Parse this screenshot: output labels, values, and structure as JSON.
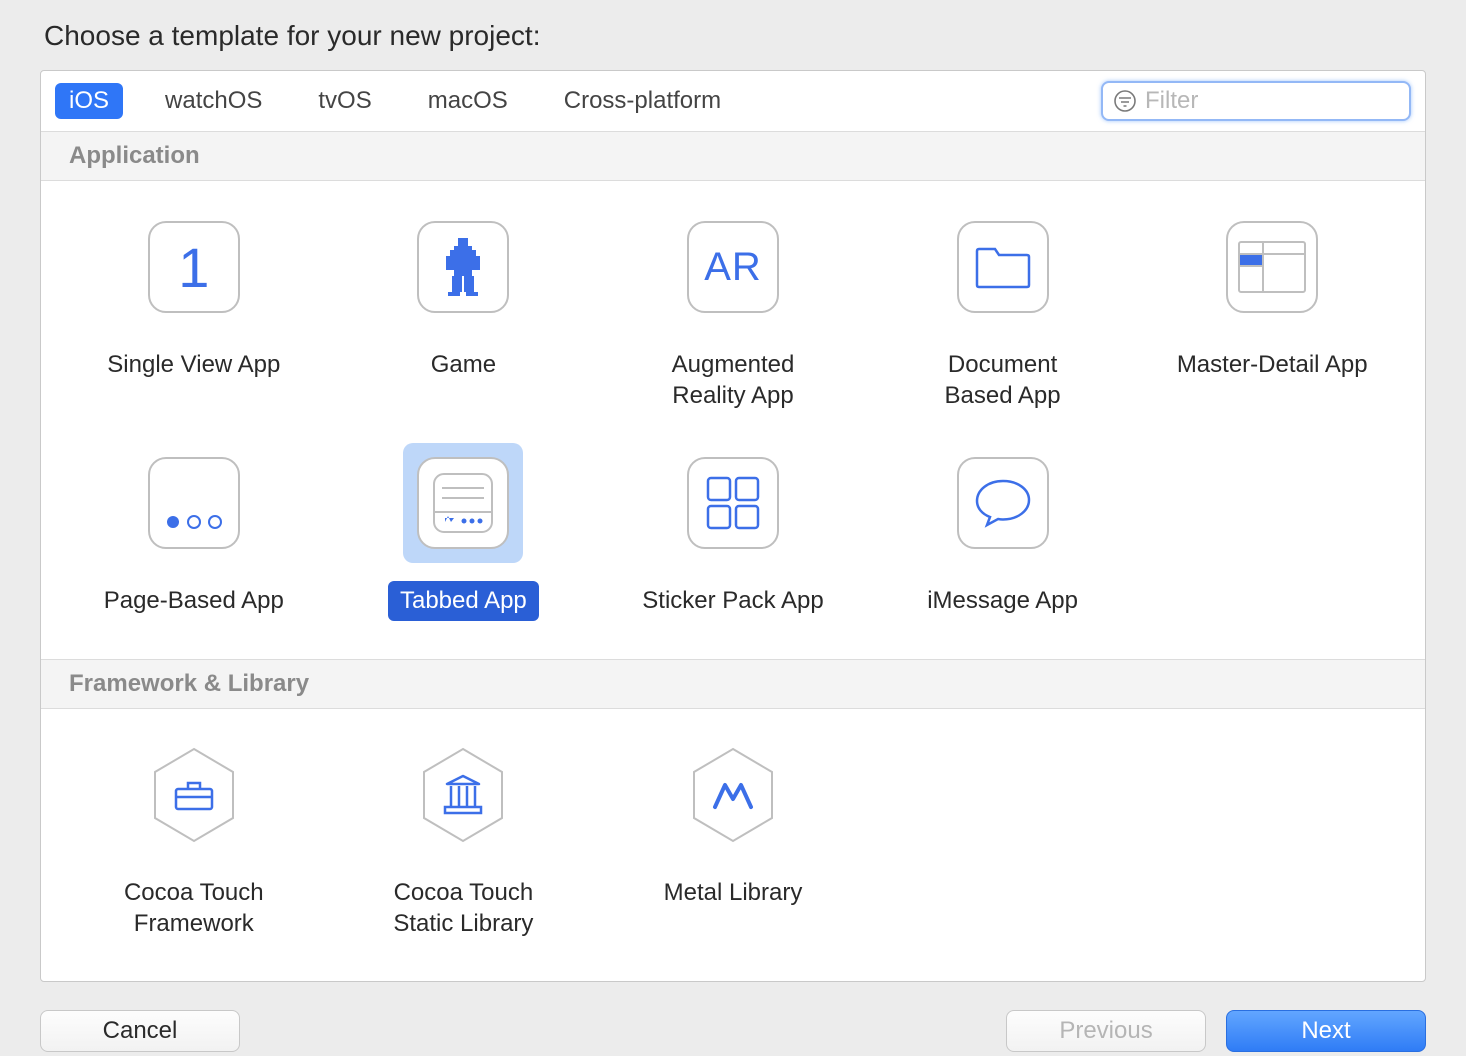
{
  "heading": "Choose a template for your new project:",
  "platforms": [
    "iOS",
    "watchOS",
    "tvOS",
    "macOS",
    "Cross-platform"
  ],
  "selected_platform_index": 0,
  "filter": {
    "placeholder": "Filter",
    "value": ""
  },
  "sections": {
    "application": {
      "title": "Application",
      "items": [
        {
          "label": "Single View App",
          "icon": "single-view-icon"
        },
        {
          "label": "Game",
          "icon": "game-icon"
        },
        {
          "label": "Augmented\nReality App",
          "icon": "ar-icon"
        },
        {
          "label": "Document\nBased App",
          "icon": "folder-icon"
        },
        {
          "label": "Master-Detail App",
          "icon": "master-detail-icon"
        },
        {
          "label": "Page-Based App",
          "icon": "page-based-icon"
        },
        {
          "label": "Tabbed App",
          "icon": "tabbed-icon",
          "selected": true
        },
        {
          "label": "Sticker Pack App",
          "icon": "sticker-icon"
        },
        {
          "label": "iMessage App",
          "icon": "imessage-icon"
        }
      ]
    },
    "framework": {
      "title": "Framework & Library",
      "items": [
        {
          "label": "Cocoa Touch\nFramework",
          "icon": "toolbox-icon"
        },
        {
          "label": "Cocoa Touch\nStatic Library",
          "icon": "library-icon"
        },
        {
          "label": "Metal Library",
          "icon": "metal-icon"
        }
      ]
    }
  },
  "buttons": {
    "cancel": "Cancel",
    "previous": "Previous",
    "next": "Next"
  },
  "colors": {
    "accent": "#3c6fe8",
    "selection_bg": "#bed7f9",
    "selection_label": "#2a5fd6"
  }
}
